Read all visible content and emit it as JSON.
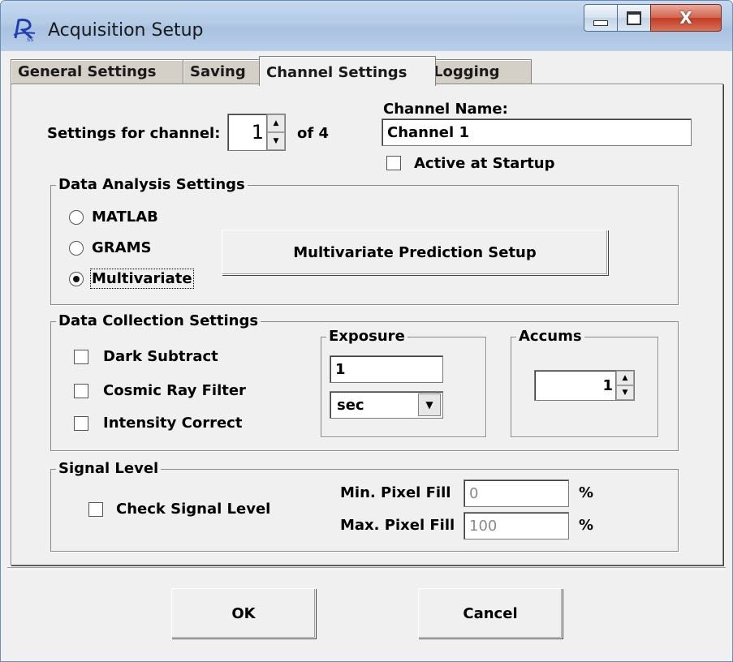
{
  "window": {
    "title": "Acquisition Setup",
    "close_glyph": "X"
  },
  "tabs": [
    {
      "label": "General Settings"
    },
    {
      "label": "Saving"
    },
    {
      "label": "Channel Settings"
    },
    {
      "label": "Logging"
    }
  ],
  "channel": {
    "settings_label": "Settings for channel:",
    "value": "1",
    "of_label": "of 4",
    "name_label": "Channel Name:",
    "name_value": "Channel 1",
    "active_label": "Active at Startup",
    "active_checked": false
  },
  "analysis": {
    "title": "Data Analysis Settings",
    "options": [
      {
        "label": "MATLAB"
      },
      {
        "label": "GRAMS"
      },
      {
        "label": "Multivariate"
      }
    ],
    "selected": "Multivariate",
    "setup_button": "Multivariate Prediction Setup"
  },
  "collection": {
    "title": "Data Collection Settings",
    "checks": [
      {
        "label": "Dark Subtract"
      },
      {
        "label": "Cosmic Ray Filter"
      },
      {
        "label": "Intensity Correct"
      }
    ],
    "exposure_title": "Exposure",
    "exposure_value": "1",
    "exposure_unit": "sec",
    "accums_title": "Accums",
    "accums_value": "1"
  },
  "signal": {
    "title": "Signal Level",
    "check_label": "Check Signal Level",
    "min_label": "Min. Pixel Fill",
    "min_value": "0",
    "max_label": "Max. Pixel Fill",
    "max_value": "100",
    "unit": "%"
  },
  "buttons": {
    "ok": "OK",
    "cancel": "Cancel"
  }
}
